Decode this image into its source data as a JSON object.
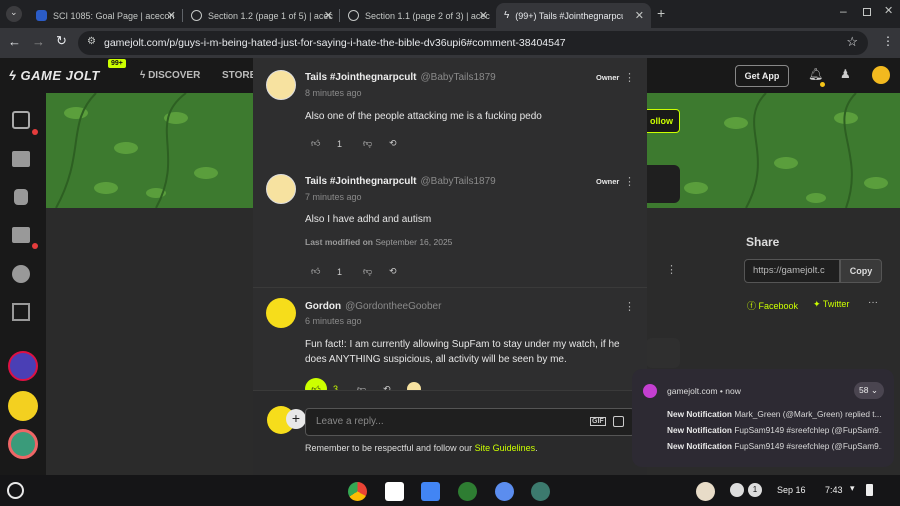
{
  "tabs": [
    {
      "title": "SCI 1085: Goal Page | acecon",
      "active": false
    },
    {
      "title": "Section 1.2 (page 1 of 5) | acec",
      "active": false
    },
    {
      "title": "Section 1.1 (page 2 of 3) | acec",
      "active": false
    },
    {
      "title": "(99+) Tails #Jointhegnarpcult",
      "active": true
    }
  ],
  "address": {
    "url": "gamejolt.com/p/guys-i-m-being-hated-just-for-saying-i-hate-the-bible-dv36upi6#comment-38404547"
  },
  "site": {
    "logo": "GAME JOLT",
    "badge": "99+",
    "nav_discover": "DISCOVER",
    "nav_store": "STORE",
    "get_app": "Get App",
    "follow": "ollow"
  },
  "share": {
    "title": "Share",
    "url_value": "https://gamejolt.c",
    "copy": "Copy",
    "facebook": "Facebook",
    "twitter": "Twitter",
    "more": "···"
  },
  "comments": [
    {
      "name": "Tails #Jointhegnarpcult",
      "handle": "@BabyTails1879",
      "time": "8 minutes ago",
      "badge": "Owner",
      "text": "Also one of the people attacking me is a fucking pedo",
      "likes": "1",
      "modified_label": "",
      "modified_date": ""
    },
    {
      "name": "Tails #Jointhegnarpcult",
      "handle": "@BabyTails1879",
      "time": "7 minutes ago",
      "badge": "Owner",
      "text": "Also I have adhd and autism",
      "likes": "1",
      "modified_label": "Last modified on",
      "modified_date": "September 16, 2025"
    },
    {
      "name": "Gordon",
      "handle": "@GordontheeGoober",
      "time": "6 minutes ago",
      "badge": "",
      "text": "Fun fact!: I am currently allowing SupFam to stay under my watch, if he does ANYTHING suspicious, all activity will be seen by me.",
      "likes": "3",
      "modified_label": "",
      "modified_date": ""
    }
  ],
  "reply": {
    "placeholder": "Leave a reply...",
    "gif": "GIF",
    "guideline_prefix": "Remember to be respectful and follow our",
    "guideline_link": "Site Guidelines",
    "guideline_suffix": "."
  },
  "notification": {
    "source": "gamejolt.com • now",
    "count": "58",
    "lines": [
      {
        "label": "New Notification",
        "text": "Mark_Green (@Mark_Green) replied t..."
      },
      {
        "label": "New Notification",
        "text": "FupSam9149 #sreefchlep (@FupSam9..."
      },
      {
        "label": "New Notification",
        "text": "FupSam9149 #sreefchlep (@FupSam9..."
      }
    ]
  },
  "shelf": {
    "date": "Sep 16",
    "time": "7:43",
    "tray_count": "1"
  },
  "colors": {
    "accent": "#ccff00",
    "link": "#ccff00",
    "banner": "#3d7a2f",
    "modal": "#2e2e2f",
    "page": "#2b2b2b"
  }
}
